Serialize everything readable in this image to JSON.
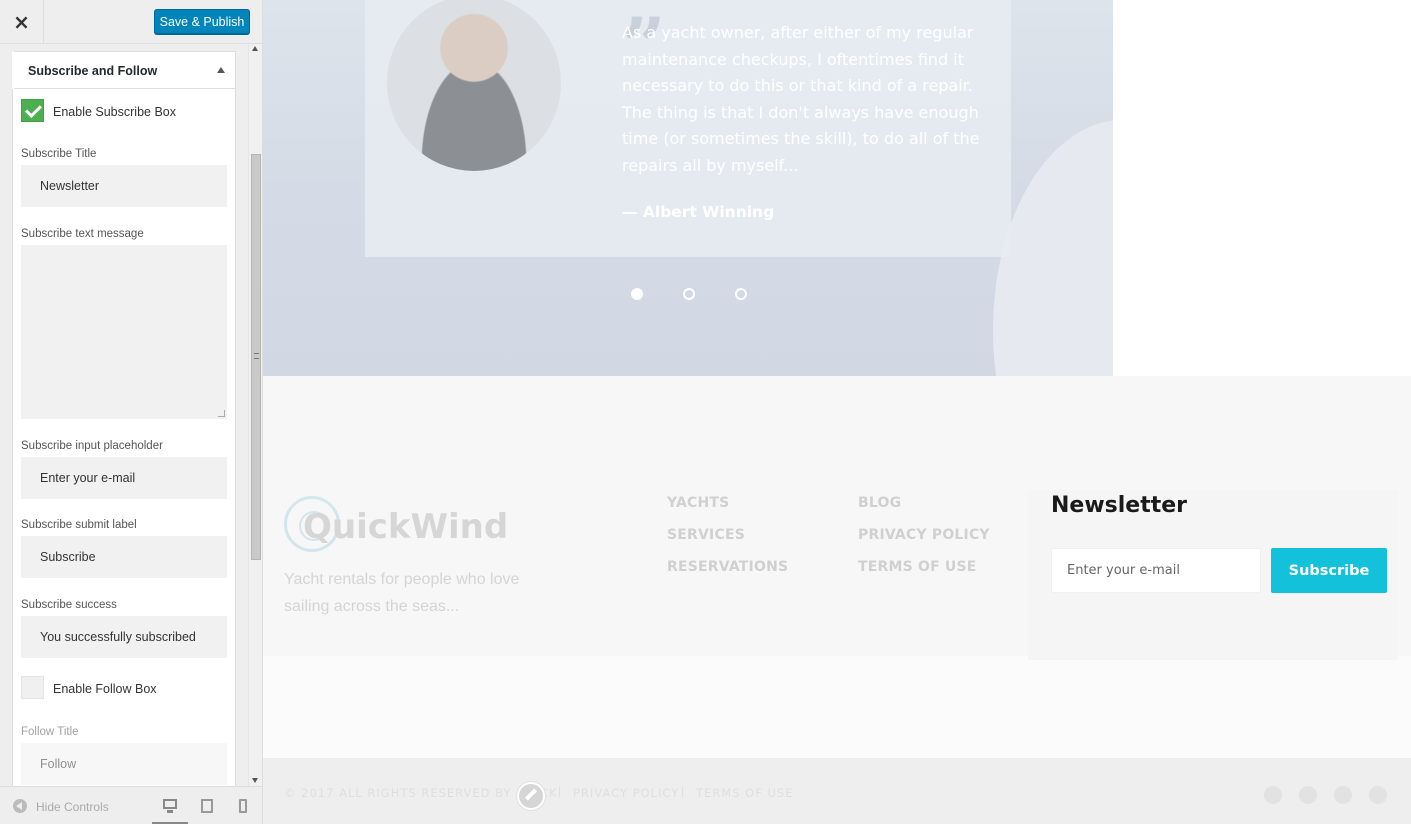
{
  "customizer": {
    "close_glyph": "×",
    "save_label": "Save & Publish",
    "section_title": "Subscribe and Follow",
    "enable_subscribe_label": "Enable Subscribe Box",
    "enable_subscribe_checked": true,
    "fields": {
      "subscribe_title_label": "Subscribe Title",
      "subscribe_title_value": "Newsletter",
      "subscribe_text_label": "Subscribe text message",
      "subscribe_text_value": "",
      "placeholder_label": "Subscribe input placeholder",
      "placeholder_value": "Enter your e-mail",
      "submit_label_label": "Subscribe submit label",
      "submit_label_value": "Subscribe",
      "success_label": "Subscribe success",
      "success_value": "You successfully subscribed"
    },
    "enable_follow_label": "Enable Follow Box",
    "enable_follow_checked": false,
    "follow_title_label": "Follow Title",
    "follow_title_value": "Follow",
    "hide_controls_label": "Hide Controls"
  },
  "preview": {
    "testimonial": {
      "quote_mark": "”",
      "text": "As a yacht owner, after either of my regular maintenance checkups, I oftentimes find it necessary to do this or that kind of a repair. The thing is that I don't always have enough time (or sometimes the skill), to do all of the repairs all by myself...",
      "author": "— Albert Winning",
      "active_slide": 1,
      "slide_count": 3
    },
    "footer": {
      "logo": "QuickWind",
      "tagline": "Yacht rentals for people who love sailing across the seas...",
      "links_col1": [
        "YACHTS",
        "SERVICES",
        "RESERVATIONS"
      ],
      "links_col2": [
        "BLOG",
        "PRIVACY POLICY",
        "TERMS OF USE"
      ],
      "newsletter": {
        "title": "Newsletter",
        "placeholder": "Enter your e-mail",
        "button": "Subscribe"
      }
    },
    "bottom_bar": {
      "copyright": "© 2017 ALL RIGHTS RESERVED BY QUICK",
      "privacy": "PRIVACY POLICY",
      "terms": "TERMS OF USE",
      "separator": "|",
      "social_icons": [
        "facebook-icon",
        "twitter-icon",
        "google-plus-icon",
        "instagram-icon"
      ]
    }
  },
  "colors": {
    "save_button": "#0085ba",
    "checkbox_on": "#4caf50",
    "subscribe_button": "#13c1da"
  }
}
